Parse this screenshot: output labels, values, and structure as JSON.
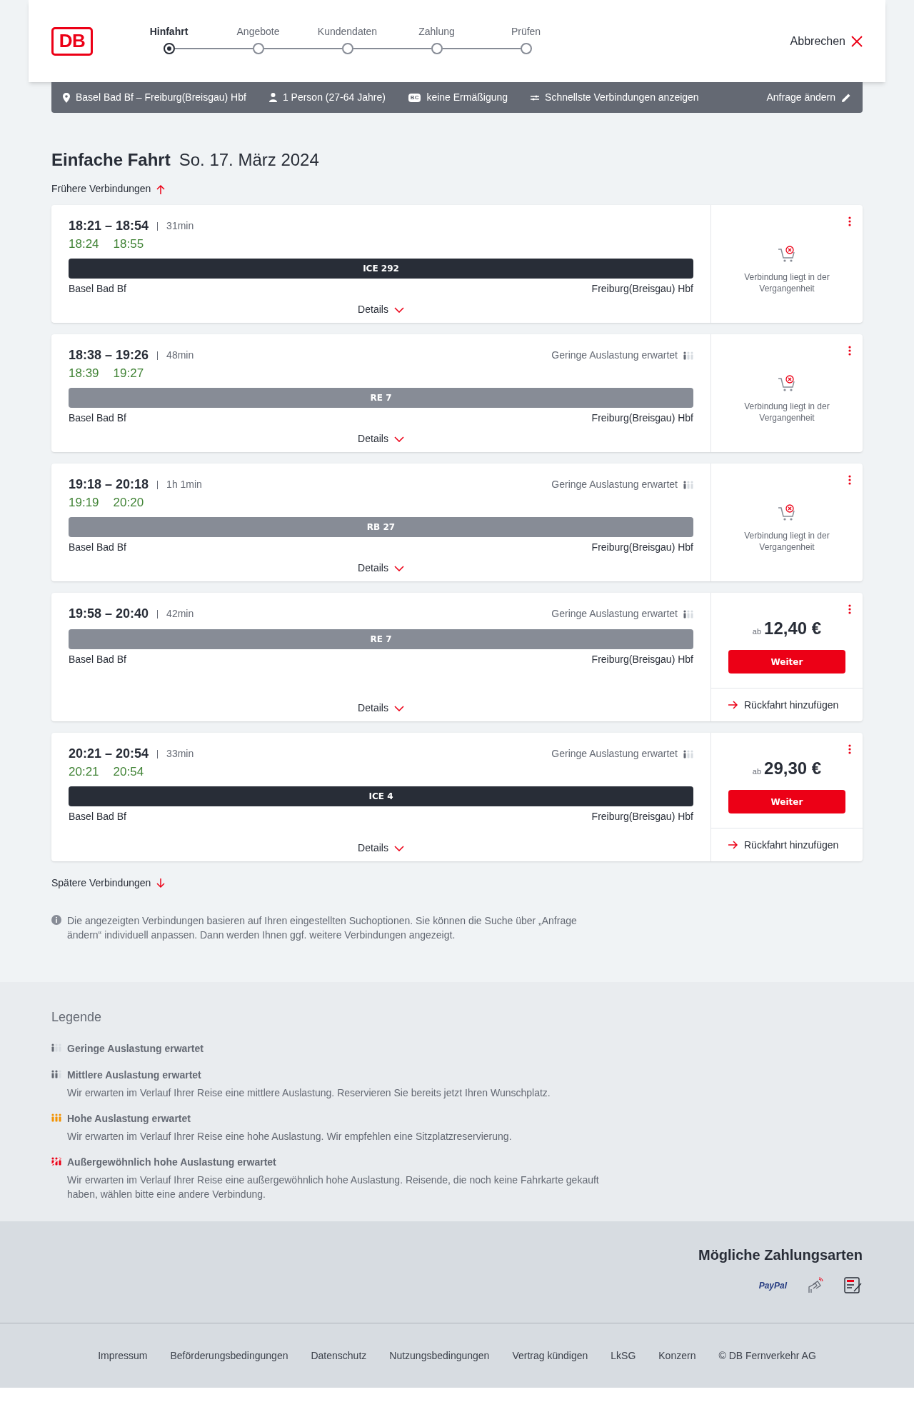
{
  "header": {
    "logo": "DB",
    "steps": [
      {
        "label": "Hinfahrt",
        "selected": true
      },
      {
        "label": "Angebote",
        "selected": false
      },
      {
        "label": "Kundendaten",
        "selected": false
      },
      {
        "label": "Zahlung",
        "selected": false
      },
      {
        "label": "Prüfen",
        "selected": false
      }
    ],
    "cancel": "Abbrechen"
  },
  "summary": {
    "route": "Basel Bad Bf – Freiburg(Breisgau) Hbf",
    "travellers": "1 Person (27-64 Jahre)",
    "discount_badge": "BC",
    "discount": "keine Ermäßigung",
    "option": "Schnellste Verbindungen anzeigen",
    "edit": "Anfrage ändern"
  },
  "title": "Einfache Fahrt",
  "date": "So. 17. März 2024",
  "earlier": "Frühere Verbindungen",
  "connections": [
    {
      "times": "18:21 – 18:54",
      "duration": "31min",
      "realtime": [
        "18:24",
        "18:55"
      ],
      "train": "ICE 292",
      "kind": "long",
      "from": "Basel Bad Bf",
      "to": "Freiburg(Breisgau) Hbf",
      "details": "Details",
      "offer": {
        "kind": "past",
        "text": "Verbindung liegt in der Vergangenheit"
      }
    },
    {
      "times": "18:38 – 19:26",
      "duration": "48min",
      "occupancy": {
        "kind": "low",
        "text": "Geringe Auslastung erwartet"
      },
      "realtime": [
        "18:39",
        "19:27"
      ],
      "train": "RE 7",
      "kind": "regional",
      "from": "Basel Bad Bf",
      "to": "Freiburg(Breisgau) Hbf",
      "details": "Details",
      "offer": {
        "kind": "past",
        "text": "Verbindung liegt in der Vergangenheit"
      }
    },
    {
      "times": "19:18 – 20:18",
      "duration": "1h 1min",
      "occupancy": {
        "kind": "low",
        "text": "Geringe Auslastung erwartet"
      },
      "realtime": [
        "19:19",
        "20:20"
      ],
      "train": "RB 27",
      "kind": "regional",
      "from": "Basel Bad Bf",
      "to": "Freiburg(Breisgau) Hbf",
      "details": "Details",
      "offer": {
        "kind": "past",
        "text": "Verbindung liegt in der Vergangenheit"
      }
    },
    {
      "times": "19:58 – 20:40",
      "duration": "42min",
      "occupancy": {
        "kind": "low",
        "text": "Geringe Auslastung erwartet"
      },
      "train": "RE 7",
      "kind": "regional",
      "from": "Basel Bad Bf",
      "to": "Freiburg(Breisgau) Hbf",
      "details": "Details",
      "offer": {
        "kind": "price",
        "prefix": "ab",
        "price": "12,40 €",
        "button": "Weiter",
        "return": "Rückfahrt hinzufügen"
      }
    },
    {
      "times": "20:21 – 20:54",
      "duration": "33min",
      "occupancy": {
        "kind": "low",
        "text": "Geringe Auslastung erwartet"
      },
      "realtime": [
        "20:21",
        "20:54"
      ],
      "train": "ICE 4",
      "kind": "long",
      "from": "Basel Bad Bf",
      "to": "Freiburg(Breisgau) Hbf",
      "details": "Details",
      "offer": {
        "kind": "price",
        "prefix": "ab",
        "price": "29,30 €",
        "button": "Weiter",
        "return": "Rückfahrt hinzufügen"
      }
    }
  ],
  "later": "Spätere Verbindungen",
  "info": "Die angezeigten Verbindungen basieren auf Ihren eingestellten Suchoptionen. Sie können die Suche über „Anfrage ändern“ individuell anpassen. Dann werden Ihnen ggf. weitere Verbindungen angezeigt.",
  "legend": {
    "title": "Legende",
    "items": [
      {
        "kind": "low",
        "title": "Geringe Auslastung erwartet"
      },
      {
        "kind": "medium",
        "title": "Mittlere Auslastung erwartet",
        "text": "Wir erwarten im Verlauf Ihrer Reise eine mittlere Auslastung. Reservieren Sie bereits jetzt Ihren Wunschplatz."
      },
      {
        "kind": "high",
        "title": "Hohe Auslastung erwartet",
        "text": "Wir erwarten im Verlauf Ihrer Reise eine hohe Auslastung. Wir empfehlen eine Sitzplatzreservierung."
      },
      {
        "kind": "extreme",
        "title": "Außergewöhnlich hohe Auslastung erwartet",
        "text": "Wir erwarten im Verlauf Ihrer Reise eine außergewöhnlich hohe Auslastung. Reisende, die noch keine Fahrkarte gekauft haben, wählen bitte eine andere Verbindung."
      }
    ]
  },
  "payment": {
    "title": "Mögliche Zahlungsarten",
    "methods": [
      {
        "kind": "paypal",
        "label": "PayPal"
      },
      {
        "kind": "contactless"
      },
      {
        "kind": "sepa"
      }
    ]
  },
  "footer_links": [
    "Impressum",
    "Beförderungsbedingungen",
    "Datenschutz",
    "Nutzungsbedingungen",
    "Vertrag kündigen",
    "LkSG",
    "Konzern",
    "© DB Fernverkehr AG"
  ]
}
